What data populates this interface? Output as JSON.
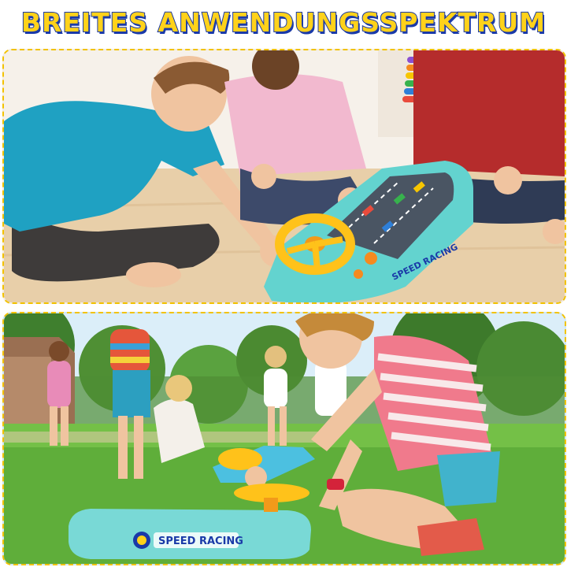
{
  "headline": {
    "text": "BREITES ANWENDUNGSSPEKTRUM",
    "fill_color": "#ffd21a",
    "outline_color": "#1a3aa8"
  },
  "top_photo": {
    "toy_label": "SPEED RACING",
    "toy_color": "#63d3cf",
    "wheel_color": "#ffc21a"
  },
  "bottom_photo": {
    "toy_label": "SPEED RACING",
    "toy_color": "#79d9d6",
    "grass_color": "#5fae3a"
  },
  "border_color": "#f2c200"
}
